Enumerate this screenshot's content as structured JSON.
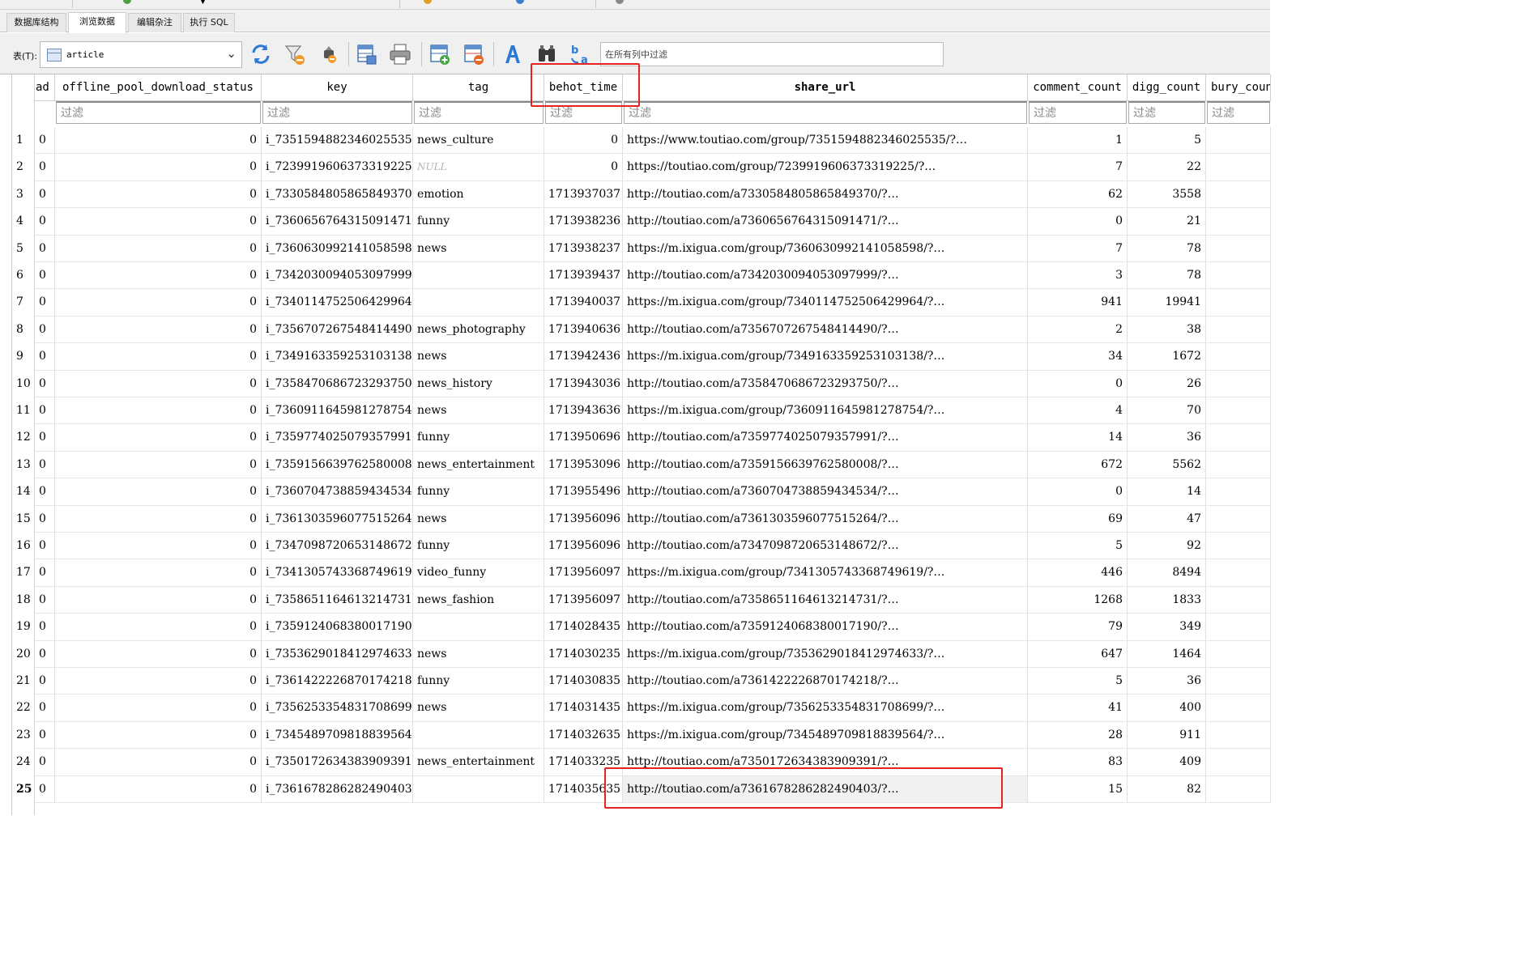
{
  "tabs": [
    {
      "label": "数据库结构",
      "active": false
    },
    {
      "label": "浏览数据",
      "active": true
    },
    {
      "label": "编辑杂注",
      "active": false
    },
    {
      "label": "执行 SQL",
      "active": false
    }
  ],
  "toolbar": {
    "table_label": "表(T):",
    "table_name": "article",
    "filter_placeholder": "在所有列中过滤",
    "icons": [
      "refresh-icon",
      "clear-filters-icon",
      "delete-filter-icon",
      "save-table-icon",
      "print-icon",
      "insert-record-icon",
      "delete-record-icon",
      "format-icon",
      "find-icon",
      "find-replace-icon"
    ]
  },
  "grid": {
    "columns": [
      {
        "key": "ad",
        "label": "ad",
        "bold": false
      },
      {
        "key": "offline",
        "label": "offline_pool_download_status",
        "bold": false
      },
      {
        "key": "key",
        "label": "key",
        "bold": false
      },
      {
        "key": "tag",
        "label": "tag",
        "bold": false
      },
      {
        "key": "behot",
        "label": "behot_time",
        "bold": false
      },
      {
        "key": "share",
        "label": "share_url",
        "bold": true
      },
      {
        "key": "comment",
        "label": "comment_count",
        "bold": false
      },
      {
        "key": "digg",
        "label": "digg_count",
        "bold": false
      },
      {
        "key": "bury",
        "label": "bury_coun",
        "bold": false
      }
    ],
    "filter_placeholder": "过滤",
    "null_text": "NULL",
    "active_row": 25,
    "rows": [
      {
        "n": "1",
        "ad": "0",
        "offline": "0",
        "key": "i_7351594882346025535",
        "tag": "news_culture",
        "behot": "0",
        "share": "https://www.toutiao.com/group/7351594882346025535/?…",
        "comment": "1",
        "digg": "5",
        "bury": ""
      },
      {
        "n": "2",
        "ad": "0",
        "offline": "0",
        "key": "i_7239919606373319225",
        "tag": null,
        "behot": "0",
        "share": "https://toutiao.com/group/7239919606373319225/?…",
        "comment": "7",
        "digg": "22",
        "bury": ""
      },
      {
        "n": "3",
        "ad": "0",
        "offline": "0",
        "key": "i_7330584805865849370",
        "tag": "emotion",
        "behot": "1713937037",
        "share": "http://toutiao.com/a7330584805865849370/?…",
        "comment": "62",
        "digg": "3558",
        "bury": ""
      },
      {
        "n": "4",
        "ad": "0",
        "offline": "0",
        "key": "i_7360656764315091471",
        "tag": "funny",
        "behot": "1713938236",
        "share": "http://toutiao.com/a7360656764315091471/?…",
        "comment": "0",
        "digg": "21",
        "bury": ""
      },
      {
        "n": "5",
        "ad": "0",
        "offline": "0",
        "key": "i_7360630992141058598",
        "tag": "news",
        "behot": "1713938237",
        "share": "https://m.ixigua.com/group/7360630992141058598/?…",
        "comment": "7",
        "digg": "78",
        "bury": ""
      },
      {
        "n": "6",
        "ad": "0",
        "offline": "0",
        "key": "i_7342030094053097999",
        "tag": "",
        "behot": "1713939437",
        "share": "http://toutiao.com/a7342030094053097999/?…",
        "comment": "3",
        "digg": "78",
        "bury": ""
      },
      {
        "n": "7",
        "ad": "0",
        "offline": "0",
        "key": "i_7340114752506429964",
        "tag": "",
        "behot": "1713940037",
        "share": "https://m.ixigua.com/group/7340114752506429964/?…",
        "comment": "941",
        "digg": "19941",
        "bury": ""
      },
      {
        "n": "8",
        "ad": "0",
        "offline": "0",
        "key": "i_7356707267548414490",
        "tag": "news_photography",
        "behot": "1713940636",
        "share": "http://toutiao.com/a7356707267548414490/?…",
        "comment": "2",
        "digg": "38",
        "bury": ""
      },
      {
        "n": "9",
        "ad": "0",
        "offline": "0",
        "key": "i_7349163359253103138",
        "tag": "news",
        "behot": "1713942436",
        "share": "https://m.ixigua.com/group/7349163359253103138/?…",
        "comment": "34",
        "digg": "1672",
        "bury": ""
      },
      {
        "n": "10",
        "ad": "0",
        "offline": "0",
        "key": "i_7358470686723293750",
        "tag": "news_history",
        "behot": "1713943036",
        "share": "http://toutiao.com/a7358470686723293750/?…",
        "comment": "0",
        "digg": "26",
        "bury": ""
      },
      {
        "n": "11",
        "ad": "0",
        "offline": "0",
        "key": "i_7360911645981278754",
        "tag": "news",
        "behot": "1713943636",
        "share": "https://m.ixigua.com/group/7360911645981278754/?…",
        "comment": "4",
        "digg": "70",
        "bury": ""
      },
      {
        "n": "12",
        "ad": "0",
        "offline": "0",
        "key": "i_7359774025079357991",
        "tag": "funny",
        "behot": "1713950696",
        "share": "http://toutiao.com/a7359774025079357991/?…",
        "comment": "14",
        "digg": "36",
        "bury": ""
      },
      {
        "n": "13",
        "ad": "0",
        "offline": "0",
        "key": "i_7359156639762580008",
        "tag": "news_entertainment",
        "behot": "1713953096",
        "share": "http://toutiao.com/a7359156639762580008/?…",
        "comment": "672",
        "digg": "5562",
        "bury": ""
      },
      {
        "n": "14",
        "ad": "0",
        "offline": "0",
        "key": "i_7360704738859434534",
        "tag": "funny",
        "behot": "1713955496",
        "share": "http://toutiao.com/a7360704738859434534/?…",
        "comment": "0",
        "digg": "14",
        "bury": ""
      },
      {
        "n": "15",
        "ad": "0",
        "offline": "0",
        "key": "i_7361303596077515264",
        "tag": "news",
        "behot": "1713956096",
        "share": "http://toutiao.com/a7361303596077515264/?…",
        "comment": "69",
        "digg": "47",
        "bury": ""
      },
      {
        "n": "16",
        "ad": "0",
        "offline": "0",
        "key": "i_7347098720653148672",
        "tag": "funny",
        "behot": "1713956096",
        "share": "http://toutiao.com/a7347098720653148672/?…",
        "comment": "5",
        "digg": "92",
        "bury": ""
      },
      {
        "n": "17",
        "ad": "0",
        "offline": "0",
        "key": "i_7341305743368749619",
        "tag": "video_funny",
        "behot": "1713956097",
        "share": "https://m.ixigua.com/group/7341305743368749619/?…",
        "comment": "446",
        "digg": "8494",
        "bury": ""
      },
      {
        "n": "18",
        "ad": "0",
        "offline": "0",
        "key": "i_7358651164613214731",
        "tag": "news_fashion",
        "behot": "1713956097",
        "share": "http://toutiao.com/a7358651164613214731/?…",
        "comment": "1268",
        "digg": "1833",
        "bury": ""
      },
      {
        "n": "19",
        "ad": "0",
        "offline": "0",
        "key": "i_7359124068380017190",
        "tag": "",
        "behot": "1714028435",
        "share": "http://toutiao.com/a7359124068380017190/?…",
        "comment": "79",
        "digg": "349",
        "bury": ""
      },
      {
        "n": "20",
        "ad": "0",
        "offline": "0",
        "key": "i_7353629018412974633",
        "tag": "news",
        "behot": "1714030235",
        "share": "https://m.ixigua.com/group/7353629018412974633/?…",
        "comment": "647",
        "digg": "1464",
        "bury": ""
      },
      {
        "n": "21",
        "ad": "0",
        "offline": "0",
        "key": "i_7361422226870174218",
        "tag": "funny",
        "behot": "1714030835",
        "share": "http://toutiao.com/a7361422226870174218/?…",
        "comment": "5",
        "digg": "36",
        "bury": ""
      },
      {
        "n": "22",
        "ad": "0",
        "offline": "0",
        "key": "i_7356253354831708699",
        "tag": "news",
        "behot": "1714031435",
        "share": "https://m.ixigua.com/group/7356253354831708699/?…",
        "comment": "41",
        "digg": "400",
        "bury": ""
      },
      {
        "n": "23",
        "ad": "0",
        "offline": "0",
        "key": "i_7345489709818839564",
        "tag": "",
        "behot": "1714032635",
        "share": "https://m.ixigua.com/group/7345489709818839564/?…",
        "comment": "28",
        "digg": "911",
        "bury": ""
      },
      {
        "n": "24",
        "ad": "0",
        "offline": "0",
        "key": "i_7350172634383909391",
        "tag": "news_entertainment",
        "behot": "1714033235",
        "share": "http://toutiao.com/a7350172634383909391/?…",
        "comment": "83",
        "digg": "409",
        "bury": ""
      },
      {
        "n": "25",
        "ad": "0",
        "offline": "0",
        "key": "i_7361678286282490403",
        "tag": "",
        "behot": "1714035635",
        "share": "http://toutiao.com/a7361678286282490403/?…",
        "comment": "15",
        "digg": "82",
        "bury": ""
      }
    ]
  },
  "colors": {
    "annotation": "#e8231f",
    "null": "#b5b5b5",
    "accent": "#2f6fb7"
  }
}
